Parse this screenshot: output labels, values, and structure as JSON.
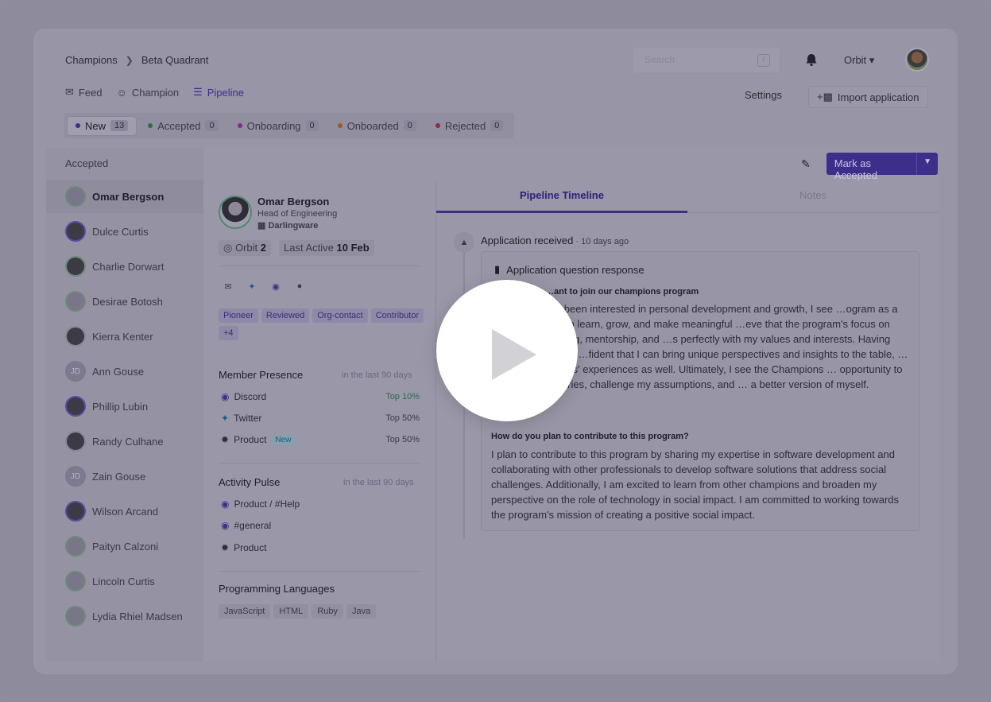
{
  "breadcrumb": {
    "root": "Champions",
    "current": "Beta Quadrant"
  },
  "search": {
    "placeholder": "Search",
    "shortcut": "/"
  },
  "workspace_menu": {
    "label": "Orbit"
  },
  "nav": {
    "feed": "Feed",
    "champion": "Champion",
    "pipeline": "Pipeline"
  },
  "actions": {
    "settings": "Settings",
    "import": "Import application"
  },
  "status_tabs": [
    {
      "label": "New",
      "count": "13",
      "color": "#3d2e8a"
    },
    {
      "label": "Accepted",
      "count": "0",
      "color": "#2e6b49"
    },
    {
      "label": "Onboarding",
      "count": "0",
      "color": "#7a2e8a"
    },
    {
      "label": "Onboarded",
      "count": "0",
      "color": "#9a5a2e"
    },
    {
      "label": "Rejected",
      "count": "0",
      "color": "#8a2e3e"
    }
  ],
  "sidebar": {
    "title": "Accepted",
    "members": [
      {
        "name": "Omar Bergson"
      },
      {
        "name": "Dulce Curtis"
      },
      {
        "name": "Charlie Dorwart"
      },
      {
        "name": "Desirae Botosh"
      },
      {
        "name": "Kierra Kenter"
      },
      {
        "name": "Ann Gouse",
        "initials": "JD"
      },
      {
        "name": "Phillip Lubin"
      },
      {
        "name": "Randy Culhane"
      },
      {
        "name": "Zain Gouse",
        "initials": "JD"
      },
      {
        "name": "Wilson Arcand"
      },
      {
        "name": "Paityn Calzoni"
      },
      {
        "name": "Lincoln Curtis"
      },
      {
        "name": "Lydia Rhiel Madsen"
      }
    ]
  },
  "profile": {
    "name": "Omar Bergson",
    "role": "Head of Engineering",
    "company": "Darlingware",
    "orbit_label": "Orbit",
    "orbit_value": "2",
    "last_active_label": "Last Active",
    "last_active_value": "10 Feb",
    "tags": [
      "Pioneer",
      "Reviewed",
      "Org-contact",
      "Contributor",
      "+4"
    ],
    "presence": {
      "title": "Member Presence",
      "note": "in the last 90 days",
      "rows": [
        {
          "label": "Discord",
          "value": "Top 10%"
        },
        {
          "label": "Twitter",
          "value": "Top 50%"
        },
        {
          "label": "Product",
          "badge": "New",
          "value": "Top 50%"
        }
      ]
    },
    "activity": {
      "title": "Activity Pulse",
      "note": "in the last 90 days",
      "rows": [
        "Product / #Help",
        "#general",
        "Product"
      ]
    },
    "languages": {
      "title": "Programming Languages",
      "items": [
        "JavaScript",
        "HTML",
        "Ruby",
        "Java"
      ]
    }
  },
  "toolbar": {
    "mark_label": "Mark as Accepted"
  },
  "timeline": {
    "tabs": [
      "Pipeline Timeline",
      "Notes"
    ],
    "event_title": "Application received",
    "event_time": " · 10 days ago",
    "card_title": "Application question response",
    "q1": "…ant to join our champions program",
    "a1": "…o has always been interested in personal development and growth, I see …ogram as a perfect platform to learn, grow, and make meaningful …eve that the program's focus on community building, mentorship, and …s perfectly with my values and interests. Having worked in different …fident that I can bring unique perspectives and insights to the table, …o learn from others' experiences as well. Ultimately, I see the Champions … opportunity to push my boundaries, challenge my assumptions, and … a better version of myself.",
    "q2": "How do you plan to contribute to this program?",
    "a2": "I plan to contribute to this program by sharing my expertise in software development and collaborating with other professionals to develop software solutions that address social challenges. Additionally, I am excited to learn from other champions and broaden my perspective on the role of technology in social impact. I am committed to working towards the program's mission of creating a positive social impact."
  }
}
